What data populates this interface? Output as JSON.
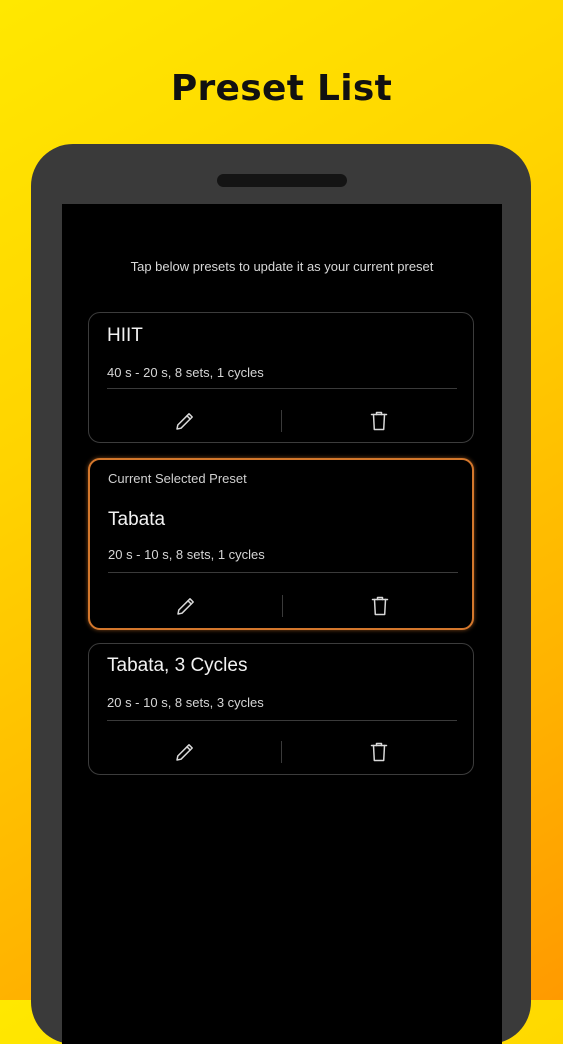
{
  "page": {
    "title": "Preset List"
  },
  "screen": {
    "hint": "Tap below presets to update it as your current preset"
  },
  "presets": [
    {
      "name": "HIIT",
      "detail": "40 s - 20 s, 8 sets, 1 cycles",
      "selected": false
    },
    {
      "caption": "Current Selected Preset",
      "name": "Tabata",
      "detail": "20 s - 10 s, 8 sets, 1 cycles",
      "selected": true
    },
    {
      "name": "Tabata, 3 Cycles",
      "detail": "20 s - 10 s, 8 sets, 3 cycles",
      "selected": false
    }
  ],
  "icons": {
    "edit": "pencil-icon",
    "delete": "trash-icon"
  },
  "colors": {
    "background_start": "#ffe800",
    "background_end": "#ff9a00",
    "selected_border": "#d4772c",
    "screen": "#000000",
    "phone_frame": "#3a3a3a"
  }
}
